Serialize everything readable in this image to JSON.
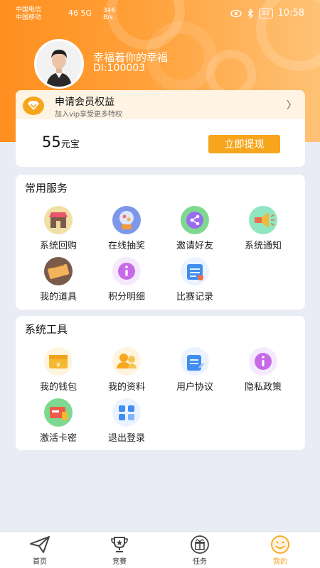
{
  "status_bar": {
    "carrier1": "中国电信",
    "carrier2": "中国移动",
    "signal": "46 5G",
    "speed_value": "346",
    "speed_unit": "B/s",
    "battery": "82",
    "time": "10:58"
  },
  "profile": {
    "name": "幸福着你的幸福",
    "id": "DI:100003"
  },
  "member": {
    "title": "申请会员权益",
    "subtitle": "加入vip享受更多特权",
    "chevron": "〉",
    "balance_value": "55",
    "balance_unit": "元宝",
    "withdraw_label": "立即提现"
  },
  "common_services": {
    "title": "常用服务",
    "items": [
      {
        "label": "系统回购",
        "icon": "shop-icon"
      },
      {
        "label": "在线抽奖",
        "icon": "lottery-icon"
      },
      {
        "label": "邀请好友",
        "icon": "share-icon"
      },
      {
        "label": "系统通知",
        "icon": "megaphone-icon"
      },
      {
        "label": "我的道具",
        "icon": "ticket-icon"
      },
      {
        "label": "积分明细",
        "icon": "info-icon"
      },
      {
        "label": "比赛记录",
        "icon": "record-icon"
      }
    ]
  },
  "system_tools": {
    "title": "系统工具",
    "items": [
      {
        "label": "我的钱包",
        "icon": "wallet-icon"
      },
      {
        "label": "我的资料",
        "icon": "profile-icon"
      },
      {
        "label": "用户协议",
        "icon": "agreement-icon"
      },
      {
        "label": "隐私政策",
        "icon": "privacy-icon"
      },
      {
        "label": "激活卡密",
        "icon": "activate-card-icon"
      },
      {
        "label": "退出登录",
        "icon": "logout-icon"
      }
    ]
  },
  "tabbar": {
    "tabs": [
      {
        "label": "首页",
        "icon": "paper-plane-icon"
      },
      {
        "label": "竞赛",
        "icon": "trophy-icon"
      },
      {
        "label": "任务",
        "icon": "gift-box-icon"
      },
      {
        "label": "我的",
        "icon": "smiley-icon"
      }
    ],
    "active_index": 3,
    "active_color": "#f6a51c"
  },
  "colors": {
    "header_orange": "#ff8f1f",
    "accent": "#f6a51c",
    "background": "#e9ecf5"
  }
}
